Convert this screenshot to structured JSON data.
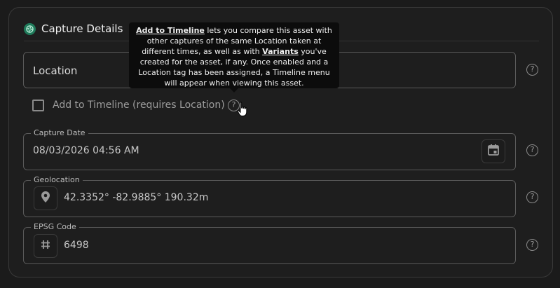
{
  "section": {
    "title": "Capture Details"
  },
  "location_field": {
    "placeholder": "Location"
  },
  "timeline": {
    "label": "Add to Timeline (requires Location)",
    "checked": false
  },
  "tooltip": {
    "link1": "Add to Timeline",
    "text1": " lets you compare this asset with other captures of the same Location taken at different times, as well as with ",
    "link2": "Variants",
    "text2": " you've created for the asset, if any. Once enabled and a Location tag has been assigned, a Timeline menu will appear when viewing this asset."
  },
  "capture_date": {
    "label": "Capture Date",
    "value": "08/03/2026 04:56 AM"
  },
  "geolocation": {
    "label": "Geolocation",
    "value": "42.3352° -82.9885° 190.32m"
  },
  "epsg": {
    "label": "EPSG Code",
    "value": "6498"
  },
  "help_glyph": "?",
  "colors": {
    "background": "#1b1b1b",
    "accent": "#1f7a5a",
    "tooltip_bg": "#0c0c0c"
  }
}
